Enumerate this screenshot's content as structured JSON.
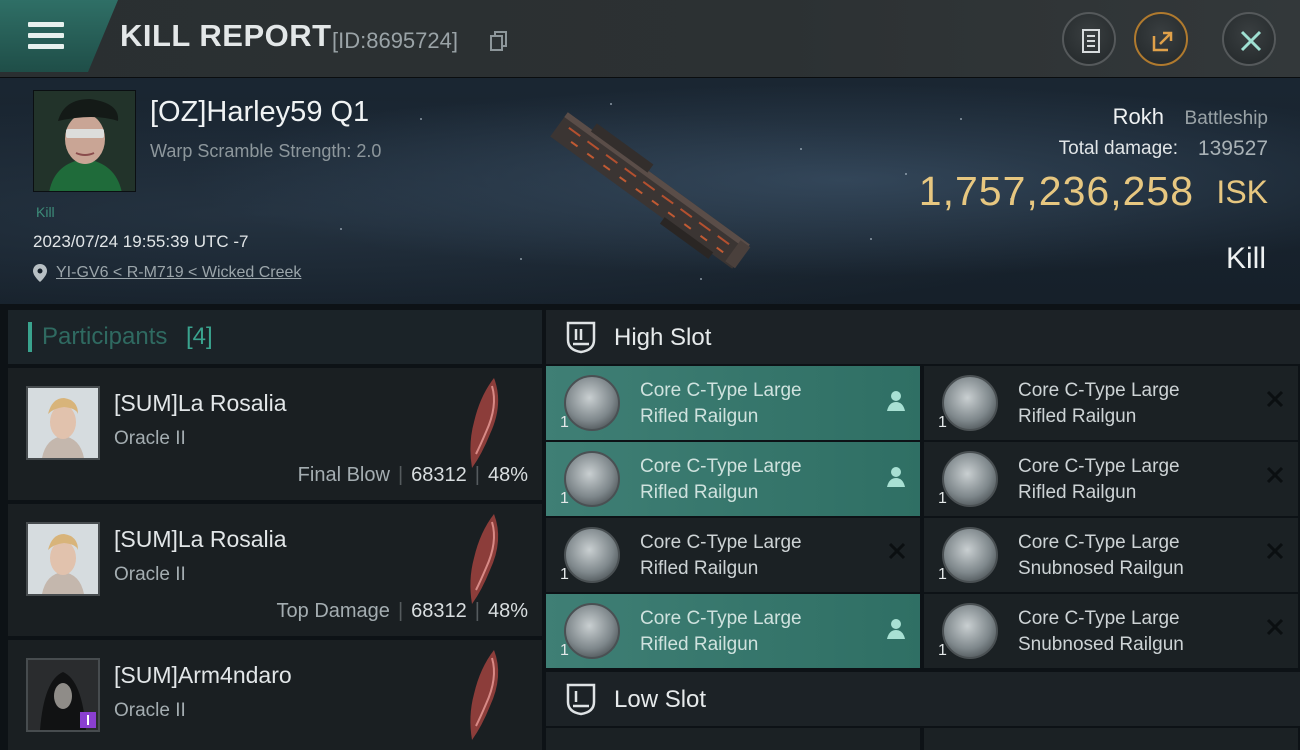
{
  "header": {
    "title": "KILL REPORT",
    "kill_id": "[ID:8695724]",
    "menu_icon": "hamburger-icon",
    "buttons": [
      "document-icon",
      "share-icon",
      "close-icon"
    ]
  },
  "victim": {
    "name": "[OZ]Harley59 Q1",
    "subtitle": "Warp Scramble Strength: 2.0",
    "tag": "Kill",
    "datetime": "2023/07/24 19:55:39 UTC -7",
    "location": "YI-GV6 < R-M719 < Wicked Creek",
    "ship_name": "Rokh",
    "ship_class": "Battleship",
    "total_damage_label": "Total damage:",
    "total_damage": "139527",
    "isk_value": "1,757,236,258",
    "isk_unit": "ISK",
    "outcome": "Kill"
  },
  "participants": {
    "label": "Participants",
    "count": "[4]",
    "rows": [
      {
        "name": "[SUM]La Rosalia",
        "ship": "Oracle II",
        "role": "Final Blow",
        "damage": "68312",
        "percent": "48%"
      },
      {
        "name": "[SUM]La Rosalia",
        "ship": "Oracle II",
        "role": "Top Damage",
        "damage": "68312",
        "percent": "48%"
      },
      {
        "name": "[SUM]Arm4ndaro",
        "ship": "Oracle II",
        "role": "",
        "damage": "",
        "percent": ""
      }
    ]
  },
  "fittings": {
    "high_slot_label": "High Slot",
    "low_slot_label": "Low Slot",
    "high_slot": [
      {
        "line1": "Core C-Type Large",
        "line2": "Rifled Railgun",
        "qty": "1",
        "status": "dropped",
        "status_icon": "person-icon"
      },
      {
        "line1": "Core C-Type Large",
        "line2": "Rifled Railgun",
        "qty": "1",
        "status": "destroyed",
        "status_icon": "x-icon"
      },
      {
        "line1": "Core C-Type Large",
        "line2": "Rifled Railgun",
        "qty": "1",
        "status": "dropped",
        "status_icon": "person-icon"
      },
      {
        "line1": "Core C-Type Large",
        "line2": "Rifled Railgun",
        "qty": "1",
        "status": "destroyed",
        "status_icon": "x-icon"
      },
      {
        "line1": "Core C-Type Large",
        "line2": "Rifled Railgun",
        "qty": "1",
        "status": "destroyed",
        "status_icon": "x-icon"
      },
      {
        "line1": "Core C-Type Large",
        "line2": "Snubnosed Railgun",
        "qty": "1",
        "status": "destroyed",
        "status_icon": "x-icon"
      },
      {
        "line1": "Core C-Type Large",
        "line2": "Rifled Railgun",
        "qty": "1",
        "status": "dropped",
        "status_icon": "person-icon"
      },
      {
        "line1": "Core C-Type Large",
        "line2": "Snubnosed Railgun",
        "qty": "1",
        "status": "destroyed",
        "status_icon": "x-icon"
      }
    ]
  },
  "colors": {
    "accent_teal": "#3aa38e",
    "isk_gold": "#e7c780",
    "dropped_highlight": "#3f7f75"
  }
}
